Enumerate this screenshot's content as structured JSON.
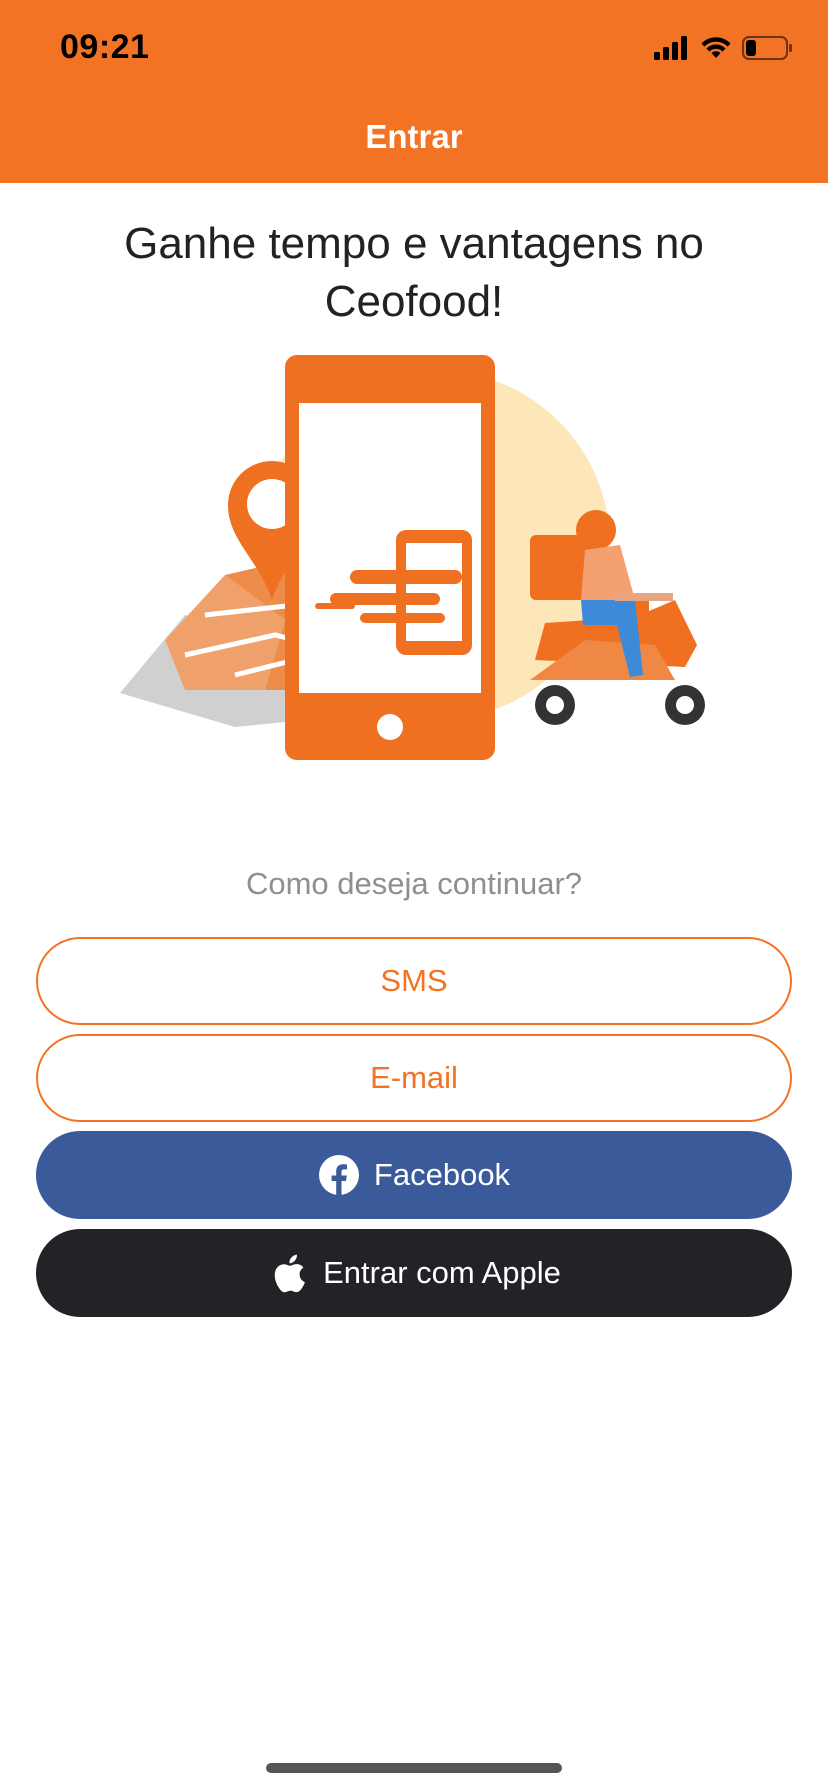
{
  "status_bar": {
    "time": "09:21",
    "icons": [
      "cellular-signal-icon",
      "wifi-icon",
      "battery-low-icon"
    ]
  },
  "nav": {
    "title": "Entrar"
  },
  "main": {
    "headline": "Ganhe tempo e vantagens no Ceofood!",
    "illustration": "delivery-illustration",
    "prompt": "Como deseja continuar?"
  },
  "buttons": {
    "sms": "SMS",
    "email": "E-mail",
    "facebook": "Facebook",
    "apple": "Entrar com Apple"
  },
  "colors": {
    "brand": "#F27323",
    "facebook": "#3B5A9A",
    "apple": "#222327",
    "prompt_text": "#8e8e93"
  }
}
